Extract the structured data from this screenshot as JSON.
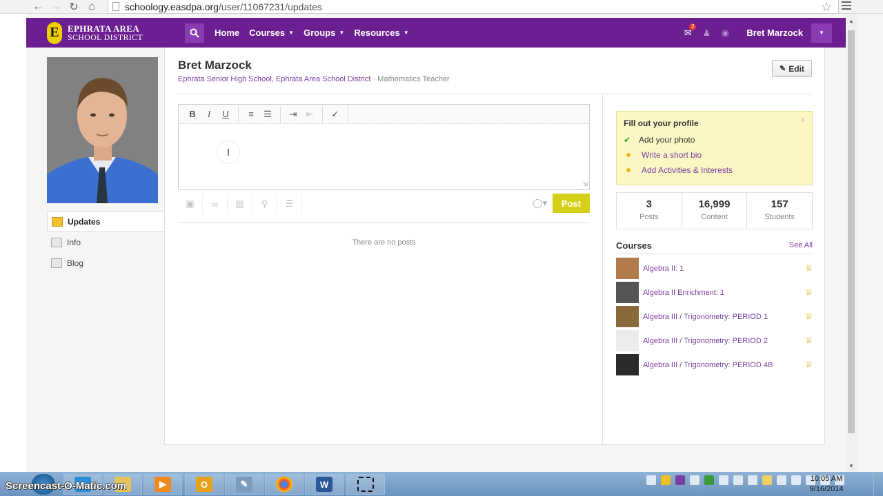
{
  "browser": {
    "url_host": "schoology.easdpa.org",
    "url_path": "/user/11067231/updates",
    "icons": [
      "back-arrow-icon",
      "forward-arrow-icon",
      "reload-icon",
      "home-icon",
      "star-icon",
      "menu-icon"
    ]
  },
  "header": {
    "logo_letter": "E",
    "logo_line1": "EPHRATA AREA",
    "logo_line2": "SCHOOL DISTRICT",
    "nav": [
      {
        "label": "Home",
        "dropdown": false
      },
      {
        "label": "Courses",
        "dropdown": true
      },
      {
        "label": "Groups",
        "dropdown": true
      },
      {
        "label": "Resources",
        "dropdown": true
      }
    ],
    "message_count": "2",
    "user_name": "Bret Marzock",
    "brand_color": "#6b1f91"
  },
  "left_nav": [
    {
      "label": "Updates",
      "icon": "updates-icon",
      "active": true
    },
    {
      "label": "Info",
      "icon": "info-icon",
      "active": false
    },
    {
      "label": "Blog",
      "icon": "blog-icon",
      "active": false
    }
  ],
  "profile": {
    "name": "Bret Marzock",
    "school": "Ephrata Senior High School",
    "district": "Ephrata Area School District",
    "separator": "·",
    "role": "Mathematics Teacher",
    "edit_label": "Edit"
  },
  "editor": {
    "toolbar": [
      {
        "label": "B",
        "name": "bold-button"
      },
      {
        "label": "I",
        "name": "italic-button"
      },
      {
        "label": "U",
        "name": "underline-button"
      }
    ],
    "post_label": "Post",
    "empty_text": "There are no posts"
  },
  "fill_profile": {
    "title": "Fill out your profile",
    "close": "x",
    "items": [
      {
        "label": "Add your photo",
        "done": true
      },
      {
        "label": "Write a short bio",
        "done": false
      },
      {
        "label": "Add Activities & Interests",
        "done": false
      }
    ]
  },
  "stats": [
    {
      "value": "3",
      "label": "Posts"
    },
    {
      "value": "16,999",
      "label": "Content"
    },
    {
      "value": "157",
      "label": "Students"
    }
  ],
  "courses": {
    "title": "Courses",
    "see_all": "See All",
    "items": [
      {
        "name": "Algebra II: 1",
        "thumb_color": "#b07a4a"
      },
      {
        "name": "Algebra II Enrichment: 1",
        "thumb_color": "#555555"
      },
      {
        "name": "Algebra III / Trigonometry: PERIOD 1",
        "thumb_color": "#8a6a3a"
      },
      {
        "name": "Algebra III / Trigonometry: PERIOD 2",
        "thumb_color": "#e8e8e8"
      },
      {
        "name": "Algebra III / Trigonometry: PERIOD 4B",
        "thumb_color": "#2a2a2a"
      }
    ]
  },
  "taskbar": {
    "watermark": "Screencast-O-Matic.com",
    "time": "10:05 AM",
    "date": "9/16/2014"
  }
}
